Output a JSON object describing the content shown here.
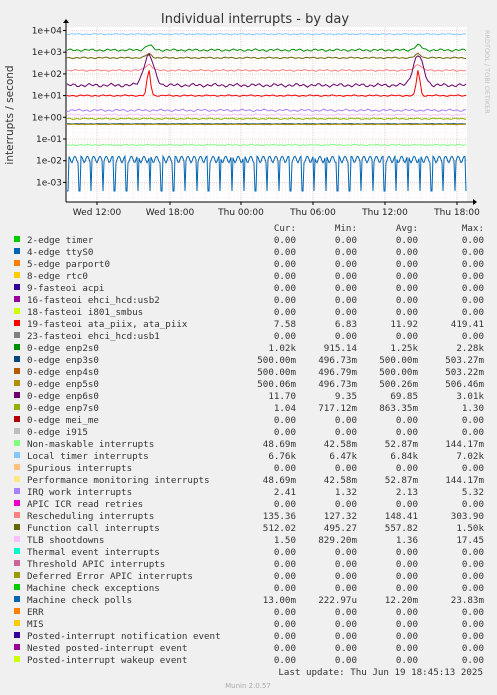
{
  "chart_data": {
    "type": "line",
    "title": "Individual interrupts - by day",
    "ylabel": "interrupts / second",
    "side_text": "RRDTOOL / TOBI OETIKER",
    "y_scale": "log",
    "ylim": [
      0.0003,
      20000
    ],
    "y_ticks": [
      "1e+04",
      "1e+03",
      "1e+02",
      "1e+01",
      "1e+00",
      "1e-01",
      "1e-02",
      "1e-03"
    ],
    "x_ticks": [
      "Wed 12:00",
      "Wed 18:00",
      "Thu 00:00",
      "Thu 06:00",
      "Thu 12:00",
      "Thu 18:00"
    ],
    "columns": [
      "Cur:",
      "Min:",
      "Avg:",
      "Max:"
    ],
    "series": [
      {
        "name": "2-edge      timer",
        "color": "#00cc00",
        "cur": "0.00",
        "min": "0.00",
        "avg": "0.00",
        "max": "0.00"
      },
      {
        "name": "4-edge      ttyS0",
        "color": "#0066b3",
        "cur": "0.00",
        "min": "0.00",
        "avg": "0.00",
        "max": "0.00"
      },
      {
        "name": "5-edge      parport0",
        "color": "#ff8000",
        "cur": "0.00",
        "min": "0.00",
        "avg": "0.00",
        "max": "0.00"
      },
      {
        "name": "8-edge      rtc0",
        "color": "#ffcc00",
        "cur": "0.00",
        "min": "0.00",
        "avg": "0.00",
        "max": "0.00"
      },
      {
        "name": "9-fasteoi   acpi",
        "color": "#330099",
        "cur": "0.00",
        "min": "0.00",
        "avg": "0.00",
        "max": "0.00"
      },
      {
        "name": "16-fasteoi   ehci_hcd:usb2",
        "color": "#990099",
        "cur": "0.00",
        "min": "0.00",
        "avg": "0.00",
        "max": "0.00"
      },
      {
        "name": "18-fasteoi   i801_smbus",
        "color": "#ccff00",
        "cur": "0.00",
        "min": "0.00",
        "avg": "0.00",
        "max": "0.00"
      },
      {
        "name": "19-fasteoi   ata_piix, ata_piix",
        "color": "#ff0000",
        "cur": "7.58",
        "min": "6.83",
        "avg": "11.92",
        "max": "419.41"
      },
      {
        "name": "23-fasteoi   ehci_hcd:usb1",
        "color": "#808080",
        "cur": "0.00",
        "min": "0.00",
        "avg": "0.00",
        "max": "0.00"
      },
      {
        "name": "0-edge      enp2s0",
        "color": "#008f00",
        "cur": "1.02k",
        "min": "915.14",
        "avg": "1.25k",
        "max": "2.28k"
      },
      {
        "name": "0-edge      enp3s0",
        "color": "#00487d",
        "cur": "500.00m",
        "min": "496.73m",
        "avg": "500.00m",
        "max": "503.27m"
      },
      {
        "name": "0-edge      enp4s0",
        "color": "#b35a00",
        "cur": "500.00m",
        "min": "496.79m",
        "avg": "500.00m",
        "max": "503.22m"
      },
      {
        "name": "0-edge      enp5s0",
        "color": "#b38f00",
        "cur": "500.06m",
        "min": "496.73m",
        "avg": "500.26m",
        "max": "506.46m"
      },
      {
        "name": "0-edge      enp6s0",
        "color": "#6b006b",
        "cur": "11.70",
        "min": "9.35",
        "avg": "69.85",
        "max": "3.01k"
      },
      {
        "name": "0-edge      enp7s0",
        "color": "#8fb300",
        "cur": "1.04",
        "min": "717.12m",
        "avg": "863.35m",
        "max": "1.30"
      },
      {
        "name": "0-edge      mei_me",
        "color": "#b30000",
        "cur": "0.00",
        "min": "0.00",
        "avg": "0.00",
        "max": "0.00"
      },
      {
        "name": "0-edge      i915",
        "color": "#bebebe",
        "cur": "0.00",
        "min": "0.00",
        "avg": "0.00",
        "max": "0.00"
      },
      {
        "name": "Non-maskable interrupts",
        "color": "#80ff80",
        "cur": "48.69m",
        "min": "42.58m",
        "avg": "52.87m",
        "max": "144.17m"
      },
      {
        "name": "Local timer interrupts",
        "color": "#80c9ff",
        "cur": "6.76k",
        "min": "6.47k",
        "avg": "6.84k",
        "max": "7.02k"
      },
      {
        "name": "Spurious interrupts",
        "color": "#ffc080",
        "cur": "0.00",
        "min": "0.00",
        "avg": "0.00",
        "max": "0.00"
      },
      {
        "name": "Performance monitoring interrupts",
        "color": "#ffe680",
        "cur": "48.69m",
        "min": "42.58m",
        "avg": "52.87m",
        "max": "144.17m"
      },
      {
        "name": "IRQ work interrupts",
        "color": "#aa80ff",
        "cur": "2.41",
        "min": "1.32",
        "avg": "2.13",
        "max": "5.32"
      },
      {
        "name": "APIC ICR read retries",
        "color": "#ee00cc",
        "cur": "0.00",
        "min": "0.00",
        "avg": "0.00",
        "max": "0.00"
      },
      {
        "name": "Rescheduling interrupts",
        "color": "#ff8080",
        "cur": "135.36",
        "min": "127.32",
        "avg": "148.41",
        "max": "303.90"
      },
      {
        "name": "Function call interrupts",
        "color": "#666600",
        "cur": "512.02",
        "min": "495.27",
        "avg": "557.82",
        "max": "1.50k"
      },
      {
        "name": "TLB shootdowns",
        "color": "#ffbfff",
        "cur": "1.50",
        "min": "829.20m",
        "avg": "1.36",
        "max": "17.45"
      },
      {
        "name": "Thermal event interrupts",
        "color": "#00ffcc",
        "cur": "0.00",
        "min": "0.00",
        "avg": "0.00",
        "max": "0.00"
      },
      {
        "name": "Threshold APIC interrupts",
        "color": "#cc6699",
        "cur": "0.00",
        "min": "0.00",
        "avg": "0.00",
        "max": "0.00"
      },
      {
        "name": "Deferred Error APIC interrupts",
        "color": "#999900",
        "cur": "0.00",
        "min": "0.00",
        "avg": "0.00",
        "max": "0.00"
      },
      {
        "name": "Machine check exceptions",
        "color": "#00cc00",
        "cur": "0.00",
        "min": "0.00",
        "avg": "0.00",
        "max": "0.00"
      },
      {
        "name": "Machine check polls",
        "color": "#0066b3",
        "cur": "13.00m",
        "min": "222.97u",
        "avg": "12.20m",
        "max": "23.83m"
      },
      {
        "name": "ERR",
        "color": "#ff8000",
        "cur": "0.00",
        "min": "0.00",
        "avg": "0.00",
        "max": "0.00"
      },
      {
        "name": "MIS",
        "color": "#ffcc00",
        "cur": "0.00",
        "min": "0.00",
        "avg": "0.00",
        "max": "0.00"
      },
      {
        "name": "Posted-interrupt notification event",
        "color": "#330099",
        "cur": "0.00",
        "min": "0.00",
        "avg": "0.00",
        "max": "0.00"
      },
      {
        "name": "Nested posted-interrupt event",
        "color": "#990099",
        "cur": "0.00",
        "min": "0.00",
        "avg": "0.00",
        "max": "0.00"
      },
      {
        "name": "Posted-interrupt wakeup event",
        "color": "#ccff00",
        "cur": "0.00",
        "min": "0.00",
        "avg": "0.00",
        "max": "0.00"
      }
    ]
  },
  "footer": {
    "last_update": "Last update: Thu Jun 19 18:45:13 2025",
    "version": "Munin 2.0.57"
  }
}
